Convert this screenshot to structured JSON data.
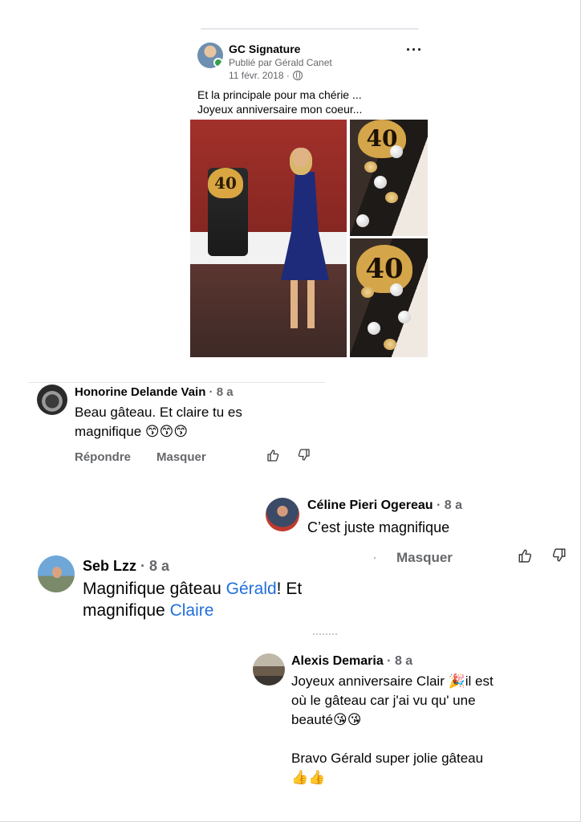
{
  "post": {
    "page_name": "GC Signature",
    "byline": "Publié par Gérald Canet",
    "date": "11 févr. 2018 ·",
    "more_label": "···",
    "text_line1": "Et la principale pour ma chérie ...",
    "text_line2": "Joyeux anniversaire mon coeur...",
    "cake_number": "40"
  },
  "comments": [
    {
      "author": "Honorine Delande Vain",
      "age": " · 8 a",
      "text": "Beau gâteau.  Et claire tu es magnifique 😙😙😙",
      "reply_label": "Répondre",
      "hide_label": "Masquer"
    },
    {
      "author": "Céline Pieri Ogereau",
      "age": " · 8 a",
      "text": "C’est juste magnifique",
      "hide_label": "Masquer"
    },
    {
      "author": "Seb Lzz",
      "age": " · 8 a",
      "text_a": "Magnifique gâteau ",
      "mention1": "Gérald",
      "text_b": "! Et magnifique ",
      "mention2": "Claire"
    },
    {
      "author": "Alexis Demaria",
      "age": " · 8 a",
      "line1": "Joyeux anniversaire Clair 🎉il est",
      "line2": "où le gâteau  car j'ai vu qu' une",
      "line3": "beauté😘😘",
      "line4": "Bravo Gérald super jolie gâteau",
      "line5": "👍👍"
    }
  ],
  "colors": {
    "link": "#216fdb",
    "muted": "#65676b",
    "online": "#31a24c"
  },
  "icons": [
    "globe-icon",
    "like-thumb-icon",
    "dislike-thumb-icon",
    "more-options-icon"
  ]
}
